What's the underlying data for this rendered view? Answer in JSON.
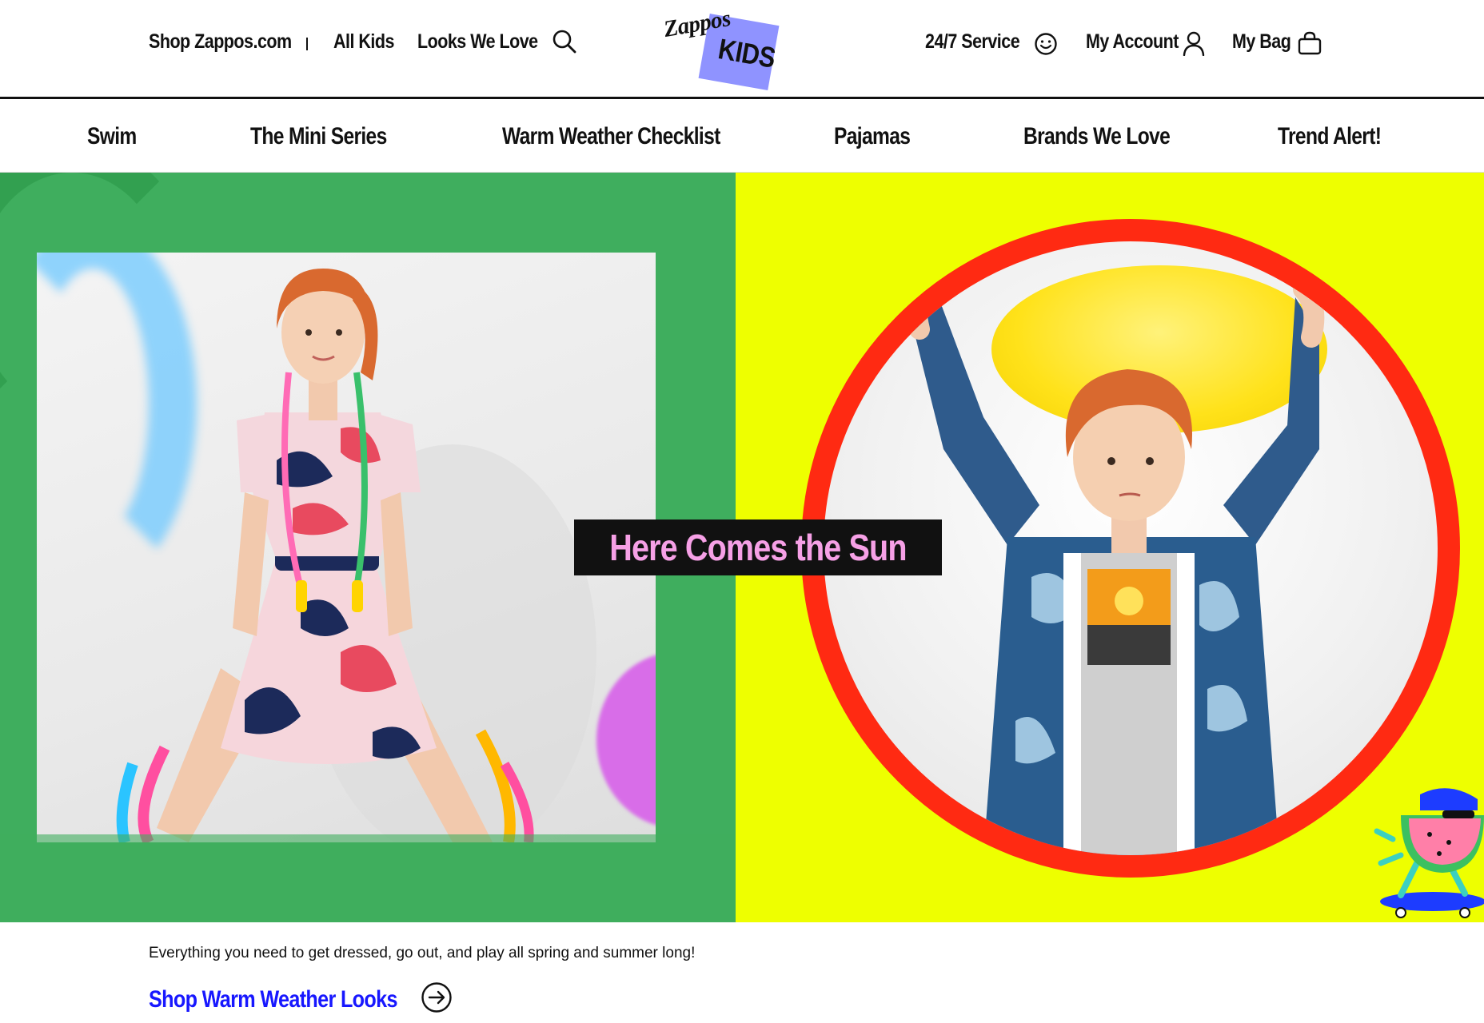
{
  "header": {
    "shop_zappos": "Shop Zappos.com",
    "all_kids": "All Kids",
    "looks_we_love": "Looks We Love",
    "search_icon": "search-icon",
    "logo_line1": "Zappos",
    "logo_line2": "KIDS",
    "service": "24/7 Service",
    "service_icon": "smiley-face-icon",
    "account": "My Account",
    "account_icon": "user-icon",
    "bag": "My Bag",
    "bag_icon": "shopping-bag-icon"
  },
  "categories": [
    {
      "label": "Swim"
    },
    {
      "label": "The Mini Series"
    },
    {
      "label": "Warm Weather Checklist"
    },
    {
      "label": "Pajamas"
    },
    {
      "label": "Brands We Love"
    },
    {
      "label": "Trend Alert!"
    }
  ],
  "hero": {
    "headline": "Here Comes the Sun",
    "left_bg": "#3fae5e",
    "right_bg": "#eeff00",
    "ring_color": "#ff2a12",
    "headline_color": "#f6a0e6"
  },
  "promo": {
    "description": "Everything you need to get dressed, go out, and play all spring and summer long!",
    "cta_label": "Shop Warm Weather Looks",
    "cta_icon": "arrow-right-circle-icon",
    "cta_color": "#1717ff"
  }
}
